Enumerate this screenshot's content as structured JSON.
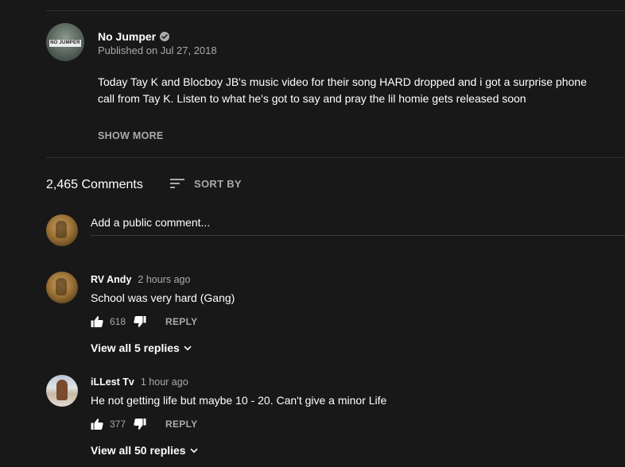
{
  "channel": {
    "name": "No Jumper",
    "avatar_label": "NO JUMPER",
    "published": "Published on Jul 27, 2018",
    "verified_icon": "verified-check-icon"
  },
  "description": {
    "text": "Today Tay K and Blocboy JB's music video for their song HARD dropped and i got a surprise phone call from Tay K. Listen to what he's got to say and pray the lil homie gets released soon",
    "show_more_label": "SHOW MORE"
  },
  "comments_header": {
    "count_label": "2,465 Comments",
    "sort_label": "SORT BY",
    "sort_icon": "sort-icon"
  },
  "add_comment": {
    "placeholder": "Add a public comment..."
  },
  "comments": [
    {
      "author": "RV Andy",
      "time": "2 hours ago",
      "text": "School was very hard (Gang)",
      "likes": "618",
      "reply_label": "REPLY",
      "view_replies": "View all 5 replies"
    },
    {
      "author": "iLLest Tv",
      "time": "1 hour ago",
      "text": "He not getting life but maybe 10 - 20. Can't give a minor Life",
      "likes": "377",
      "reply_label": "REPLY",
      "view_replies": "View all 50 replies"
    }
  ],
  "colors": {
    "background": "#181818",
    "text_primary": "#ffffff",
    "text_secondary": "#aaaaaa",
    "divider": "#303030"
  }
}
